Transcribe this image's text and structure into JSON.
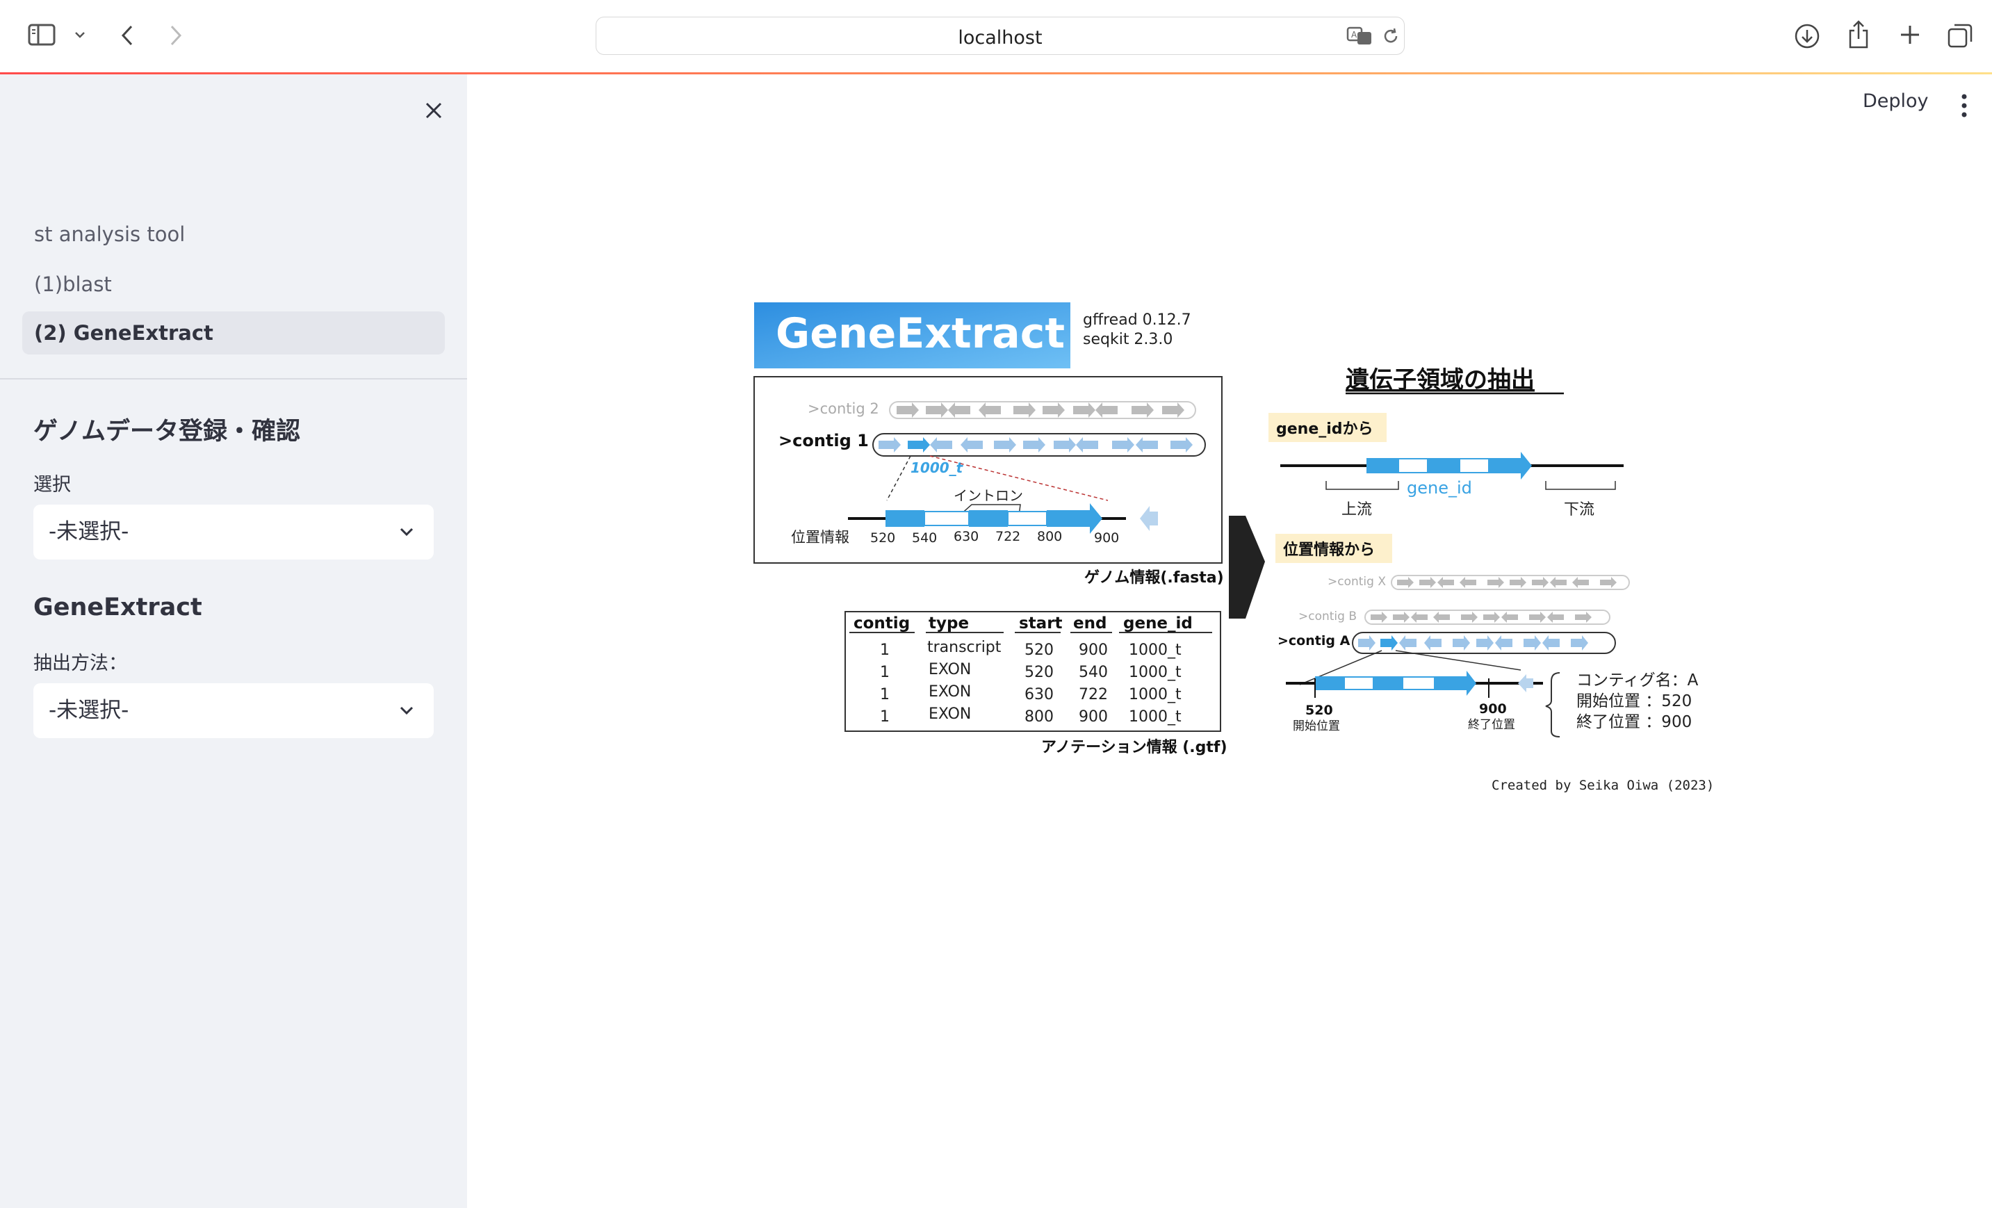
{
  "browser": {
    "url": "localhost"
  },
  "header": {
    "deploy_label": "Deploy"
  },
  "sidebar": {
    "nav": [
      {
        "label": "st analysis tool"
      },
      {
        "label": "(1)blast"
      },
      {
        "label": "(2) GeneExtract"
      }
    ],
    "section1": {
      "title": "ゲノムデータ登録・確認",
      "select_label": "選択",
      "select_value": "-未選択-"
    },
    "section2": {
      "title": "GeneExtract",
      "select_label": "抽出方法：",
      "select_value": "-未選択-"
    }
  },
  "figure": {
    "banner": "GeneExtract",
    "versions": [
      "gffread 0.12.7",
      "seqkit 2.3.0"
    ],
    "contig2": ">contig 2",
    "contig1": ">contig 1",
    "transcript_label": "1000_t",
    "intron_label": "イントロン",
    "position_label": "位置情報",
    "positions": [
      "520",
      "540",
      "630",
      "722",
      "800",
      "900"
    ],
    "fasta_caption": "ゲノム情報(.fasta)",
    "table": {
      "headers": [
        "contig",
        "type",
        "start",
        "end",
        "gene_id"
      ],
      "rows": [
        [
          "1",
          "transcript",
          "520",
          "900",
          "1000_t"
        ],
        [
          "1",
          "EXON",
          "520",
          "540",
          "1000_t"
        ],
        [
          "1",
          "EXON",
          "630",
          "722",
          "1000_t"
        ],
        [
          "1",
          "EXON",
          "800",
          "900",
          "1000_t"
        ]
      ]
    },
    "gtf_caption": "アノテーション情報 (.gtf)",
    "right_title": "遺伝子領域の抽出",
    "by_gene_id": "gene_idから",
    "gene_id_label": "gene_id",
    "upstream": "上流",
    "downstream": "下流",
    "by_position": "位置情報から",
    "contig_x": ">contig X",
    "contig_b": ">contig B",
    "contig_a": ">contig A",
    "start_val": "520",
    "start_label": "開始位置",
    "end_val": "900",
    "end_label": "終了位置",
    "info": [
      "コンティグ名：A",
      "開始位置 ：520",
      "終了位置 ：900"
    ],
    "credit": "Created by Seika Oiwa (2023)"
  }
}
